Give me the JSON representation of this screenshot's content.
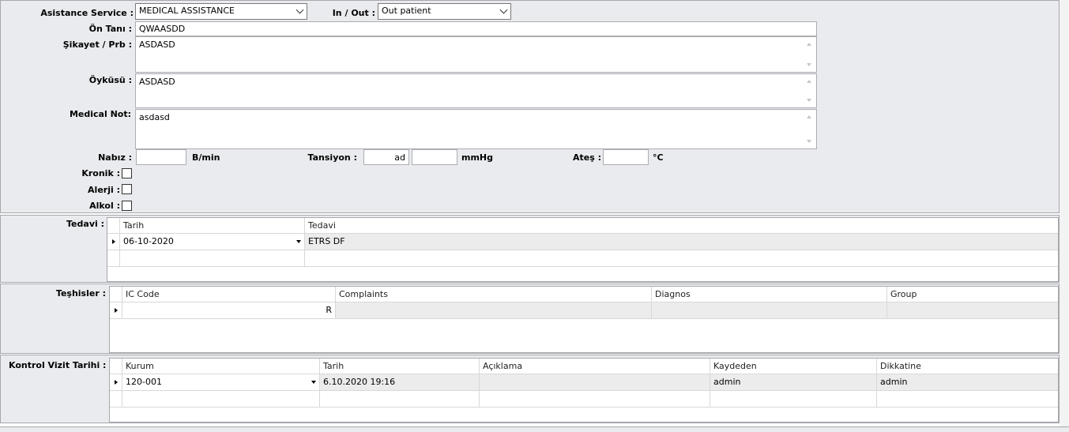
{
  "form": {
    "assistance_service_label": "Asistance Service :",
    "assistance_service_value": "MEDICAL ASSISTANCE",
    "in_out_label": "In / Out :",
    "in_out_value": "Out patient",
    "on_tani_label": "Ön Tanı :",
    "on_tani_value": "QWAASDD",
    "sikayet_label": "Şikayet / Prb :",
    "sikayet_value": "ASDASD",
    "oykusu_label": "Öyküsü :",
    "oykusu_value": "ASDASD",
    "medical_not_label": "Medical Not:",
    "medical_not_value": "asdasd",
    "nabiz_label": "Nabız :",
    "nabiz_value": "",
    "nabiz_unit": "B/min",
    "tansiyon_label": "Tansiyon :",
    "tansiyon_value1": "ad",
    "tansiyon_value2": "",
    "tansiyon_unit": "mmHg",
    "ates_label": "Ateş :",
    "ates_value": "",
    "ates_unit": "°C",
    "kronik_label": "Kronik :",
    "alerji_label": "Alerji :",
    "alkol_label": "Alkol :"
  },
  "tedavi": {
    "label": "Tedavi :",
    "columns": [
      "Tarih",
      "Tedavi"
    ],
    "rows": [
      {
        "tarih": "06-10-2020",
        "tedavi": "ETRS DF"
      }
    ]
  },
  "teshisler": {
    "label": "Teşhisler :",
    "columns": [
      "IC Code",
      "Complaints",
      "Diagnos",
      "Group"
    ],
    "rows": [
      {
        "ic_code": "R",
        "complaints": "",
        "diagnos": "",
        "group": ""
      }
    ]
  },
  "kontrol": {
    "label": "Kontrol Vizit Tarihi :",
    "columns": [
      "Kurum",
      "Tarih",
      "Açıklama",
      "Kaydeden",
      "Dikkatine"
    ],
    "rows": [
      {
        "kurum": "120-001",
        "tarih": "6.10.2020 19:16",
        "aciklama": "",
        "kaydeden": "admin",
        "dikkatine": "admin"
      }
    ]
  }
}
